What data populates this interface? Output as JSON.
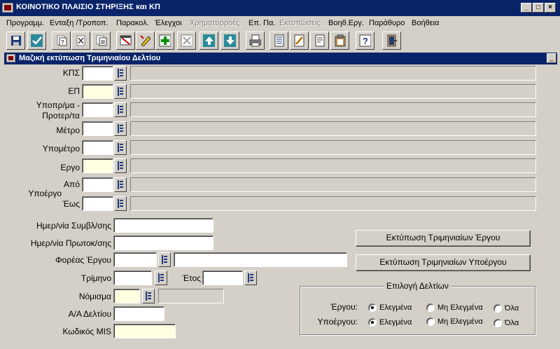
{
  "window": {
    "title": "ΚΟΙΝΟΤΙΚΟ ΠΛΑΙΣΙΟ ΣΤΗΡΙΞΗΣ και ΚΠ",
    "controls": {
      "minimize": "_",
      "maximize": "□",
      "close": "×"
    }
  },
  "menu": [
    {
      "label": "Προγραμμ.",
      "enabled": true
    },
    {
      "label": "Ενταξη /Τροποπ.",
      "enabled": true
    },
    {
      "label": "Παρακολ.",
      "enabled": true
    },
    {
      "label": "Έλεγχοι",
      "enabled": true
    },
    {
      "label": "Χρηματορροές",
      "enabled": false
    },
    {
      "label": "Επ. Πα.",
      "enabled": true
    },
    {
      "label": "Εκτυπώσεις",
      "enabled": false
    },
    {
      "label": "Βοηθ.Εργ.",
      "enabled": true
    },
    {
      "label": "Παράθυρο",
      "enabled": true
    },
    {
      "label": "Βοήθεια",
      "enabled": true
    }
  ],
  "toolbar": [
    {
      "icon": "save-icon"
    },
    {
      "icon": "check-icon"
    },
    {
      "icon": "copy-record-icon"
    },
    {
      "icon": "clear-record-icon"
    },
    {
      "icon": "duplicate-icon"
    },
    {
      "icon": "enter-query-icon"
    },
    {
      "icon": "edit-icon"
    },
    {
      "icon": "insert-record-icon"
    },
    {
      "icon": "delete-record-icon"
    },
    {
      "icon": "up-arrow-icon"
    },
    {
      "icon": "down-arrow-icon"
    },
    {
      "icon": "print-icon"
    },
    {
      "icon": "list-icon"
    },
    {
      "icon": "edit-field-icon"
    },
    {
      "icon": "document-icon"
    },
    {
      "icon": "clipboard-icon"
    },
    {
      "icon": "help-icon"
    },
    {
      "icon": "exit-icon"
    }
  ],
  "form": {
    "title": "Μαζική εκτύπωση Τριμηνιαίου Δελτίου",
    "minimize": "_",
    "fields": {
      "kps": {
        "label": "ΚΠΣ",
        "value": ""
      },
      "ep": {
        "label": "ΕΠ",
        "value": ""
      },
      "ypopr": {
        "label1": "Υποπρ/μα -",
        "label2": "Προτερ/τα",
        "value": ""
      },
      "metro": {
        "label": "Μέτρο",
        "value": ""
      },
      "ypometro": {
        "label": "Υπομέτρο",
        "value": ""
      },
      "ergo": {
        "label": "Εργο",
        "value": ""
      },
      "apo": {
        "label": "Από",
        "value": ""
      },
      "ypoergo": {
        "label": "Υποέργο",
        "value": ""
      },
      "eos": {
        "label": "Έως",
        "value": ""
      },
      "hm_symb": {
        "label": "Ημερ/νία Συμβλ/σης",
        "value": ""
      },
      "hm_prot": {
        "label": "Ημερ/νία Πρωτοκ/σης",
        "value": ""
      },
      "foreas": {
        "label": "Φορέας Έργου",
        "value": ""
      },
      "trimino": {
        "label": "Τρίμηνο",
        "value": ""
      },
      "etos": {
        "label": "Έτος",
        "value": ""
      },
      "nomisma": {
        "label": "Νόμισμα",
        "value": ""
      },
      "aa_deltiou": {
        "label": "Α/Α Δελτίου",
        "value": ""
      },
      "kodikos_mis": {
        "label": "Κωδικός MIS",
        "value": ""
      }
    },
    "buttons": {
      "print_ergou": "Εκτύπωση Τριμηνιαίων Έργου",
      "print_ypoergou": "Εκτύπωση Τριμηνιαίων Υποέργου"
    },
    "selection": {
      "title": "Επιλογή Δελτίων",
      "rows": [
        {
          "label": "Έργου:",
          "options": [
            "Ελεγμένα",
            "Μη Ελεγμένα",
            "Όλα"
          ],
          "selected": 0
        },
        {
          "label": "Υποέργου:",
          "options": [
            "Ελεγμένα",
            "Μη Ελεγμένα",
            "Όλα"
          ],
          "selected": 0
        }
      ]
    }
  }
}
